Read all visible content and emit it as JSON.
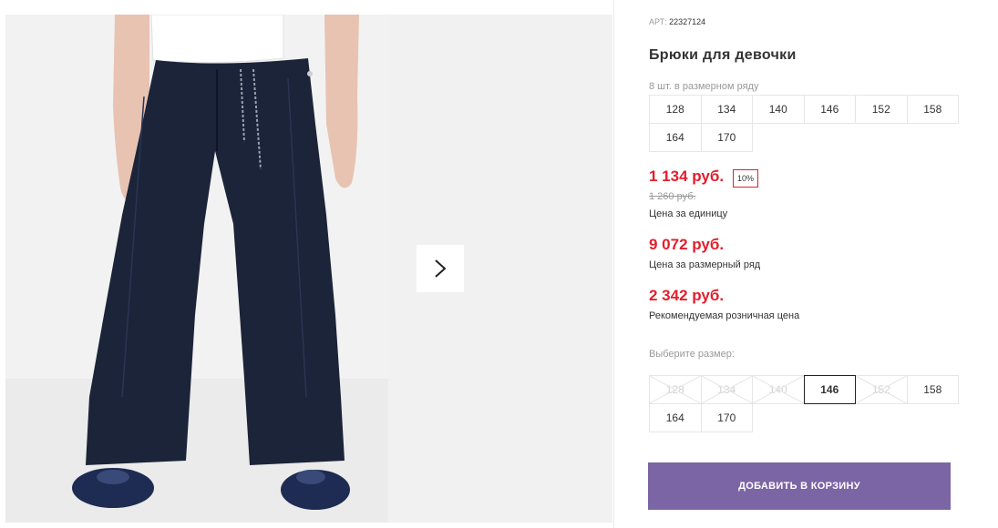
{
  "product": {
    "article_label": "АРТ:",
    "article_value": "22327124",
    "title": "Брюки для девочки",
    "series_hint": "8 шт. в размерном ряду",
    "series_sizes": [
      "128",
      "134",
      "140",
      "146",
      "152",
      "158",
      "164",
      "170"
    ]
  },
  "pricing": {
    "unit_price": "1 134 руб.",
    "discount": "10%",
    "old_price": "1 260 руб.",
    "unit_caption": "Цена за единицу",
    "series_price": "9 072 руб.",
    "series_caption": "Цена за размерный ряд",
    "retail_price": "2 342 руб.",
    "retail_caption": "Рекомендуемая розничная цена"
  },
  "size_select": {
    "label": "Выберите размер:",
    "sizes": [
      {
        "value": "128",
        "state": "disabled"
      },
      {
        "value": "134",
        "state": "disabled"
      },
      {
        "value": "140",
        "state": "disabled"
      },
      {
        "value": "146",
        "state": "selected"
      },
      {
        "value": "152",
        "state": "disabled"
      },
      {
        "value": "158",
        "state": "available"
      },
      {
        "value": "164",
        "state": "available"
      },
      {
        "value": "170",
        "state": "available"
      }
    ]
  },
  "cart": {
    "button_label": "ДОБАВИТЬ В КОРЗИНУ"
  },
  "gallery": {
    "next_icon": "chevron-right-icon"
  },
  "colors": {
    "price": "#e41e2b",
    "button": "#7b65a4",
    "pants": "#1b2438"
  }
}
